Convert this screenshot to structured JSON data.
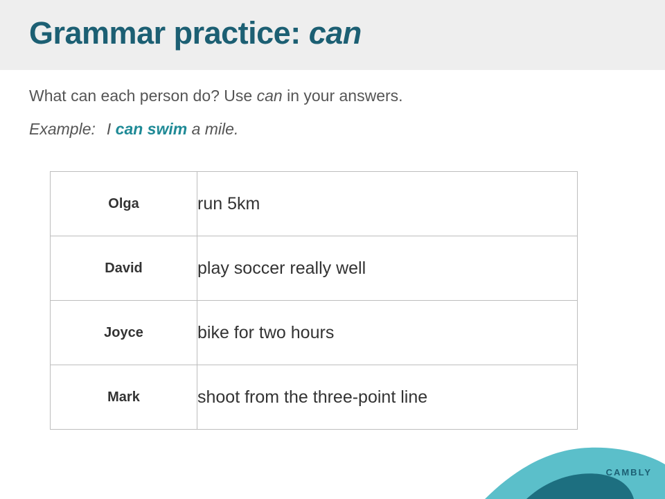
{
  "header": {
    "title_main": "Grammar practice: ",
    "title_emphasis": "can"
  },
  "instruction": {
    "before": "What can each person do? Use ",
    "emphasis": "can",
    "after": " in your answers."
  },
  "example": {
    "label": "Example:",
    "before": "I ",
    "highlight": "can swim",
    "after": " a mile."
  },
  "table": {
    "rows": [
      {
        "name": "Olga",
        "activity": "run 5km"
      },
      {
        "name": "David",
        "activity": "play soccer really well"
      },
      {
        "name": "Joyce",
        "activity": "bike for two hours"
      },
      {
        "name": "Mark",
        "activity": "shoot from the three-point line"
      }
    ]
  },
  "brand": {
    "logo_text": "CAMBLY",
    "colors": {
      "title": "#1c5f73",
      "highlight": "#1f8a96",
      "wave_light": "#5bbfca",
      "wave_dark": "#1d6f80"
    }
  }
}
